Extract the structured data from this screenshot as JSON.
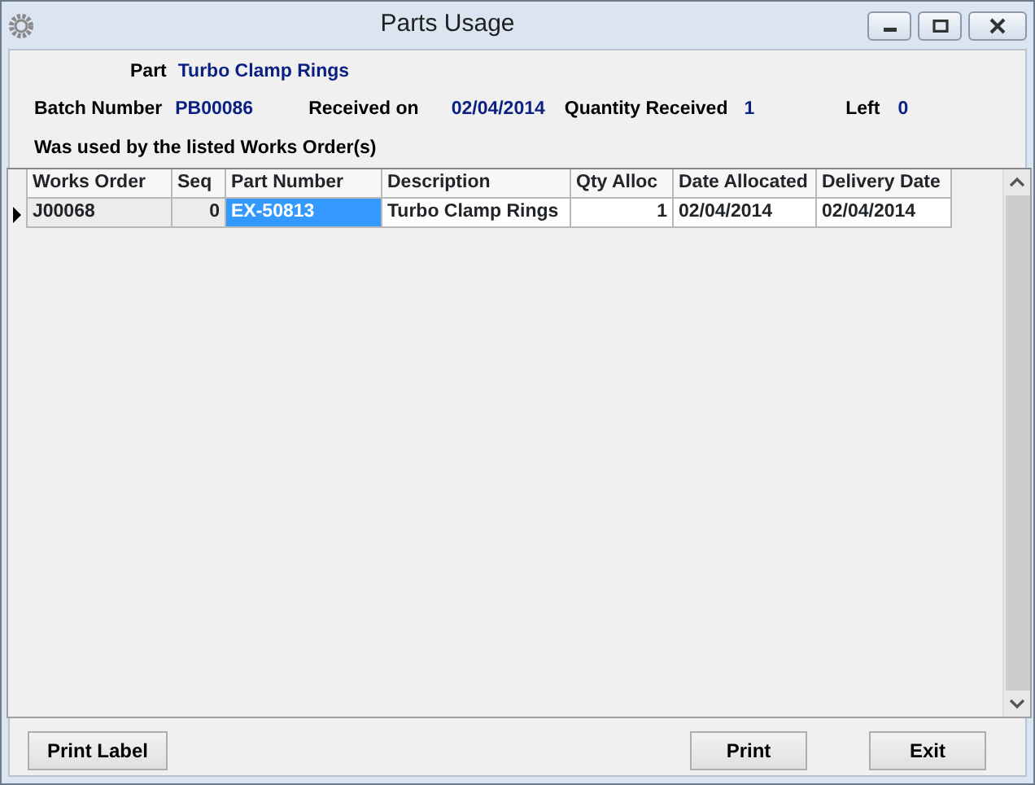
{
  "window": {
    "title": "Parts Usage"
  },
  "part": {
    "label": "Part",
    "value": "Turbo Clamp Rings"
  },
  "info": [
    {
      "label": "Batch Number",
      "value": "PB00086"
    },
    {
      "label": "Received on",
      "value": "02/04/2014"
    },
    {
      "label": "Quantity Received",
      "value": "1"
    },
    {
      "label": "Left",
      "value": "0"
    }
  ],
  "note": "Was used by the listed Works Order(s)",
  "table": {
    "columns": [
      {
        "label": "Works Order",
        "kind": "text"
      },
      {
        "label": "Seq",
        "kind": "number"
      },
      {
        "label": "Part Number",
        "kind": "text"
      },
      {
        "label": "Description",
        "kind": "text"
      },
      {
        "label": "Qty Alloc",
        "kind": "number"
      },
      {
        "label": "Date Allocated",
        "kind": "text"
      },
      {
        "label": "Delivery Date",
        "kind": "text"
      }
    ],
    "rows": [
      {
        "selected": true,
        "cells": [
          {
            "text": "J00068",
            "highlighted": false
          },
          {
            "text": "0",
            "highlighted": false
          },
          {
            "text": "EX-50813",
            "highlighted": true
          },
          {
            "text": "Turbo Clamp Rings",
            "highlighted": false
          },
          {
            "text": "1",
            "highlighted": false
          },
          {
            "text": "02/04/2014",
            "highlighted": false
          },
          {
            "text": "02/04/2014",
            "highlighted": false
          }
        ]
      }
    ]
  },
  "buttons": {
    "left": [
      "Print Label"
    ],
    "right": [
      "Print",
      "Exit"
    ]
  }
}
